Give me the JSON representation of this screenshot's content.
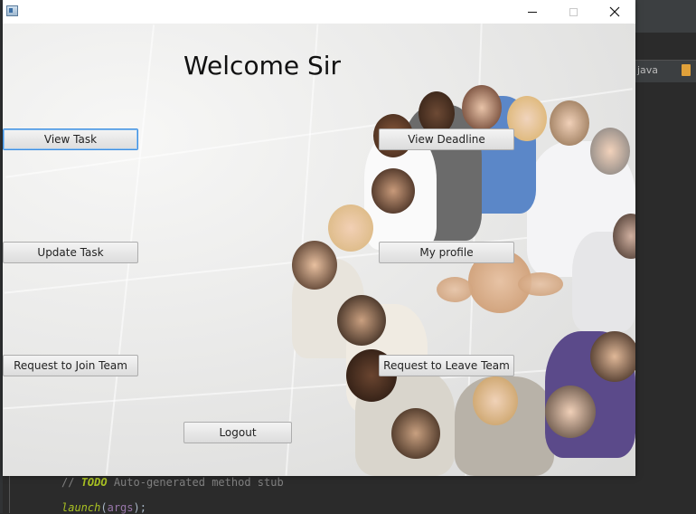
{
  "ide": {
    "tab_label": "java",
    "code_line1_keyword": "TODO",
    "code_line1_text": "// TODO Auto-generated method stub",
    "code_line1_prefix": "//",
    "code_line1_rest": "Auto-generated method stub",
    "code_line2_fn": "launch",
    "code_line2_arg": "args"
  },
  "window": {
    "controls": {
      "minimize": "minimize",
      "maximize": "maximize",
      "close": "close"
    },
    "close_glyph": "✕"
  },
  "main": {
    "welcome": "Welcome Sir",
    "buttons": {
      "view_task": "View Task",
      "view_deadline": "View Deadline",
      "update_task": "Update Task",
      "my_profile": "My profile",
      "join_team": "Request to Join Team",
      "leave_team": "Request to Leave Team",
      "logout": "Logout"
    }
  },
  "colors": {
    "focus_border": "#3d8ee0",
    "window_bg": "#ffffff",
    "ide_bg": "#2b2b2b"
  }
}
